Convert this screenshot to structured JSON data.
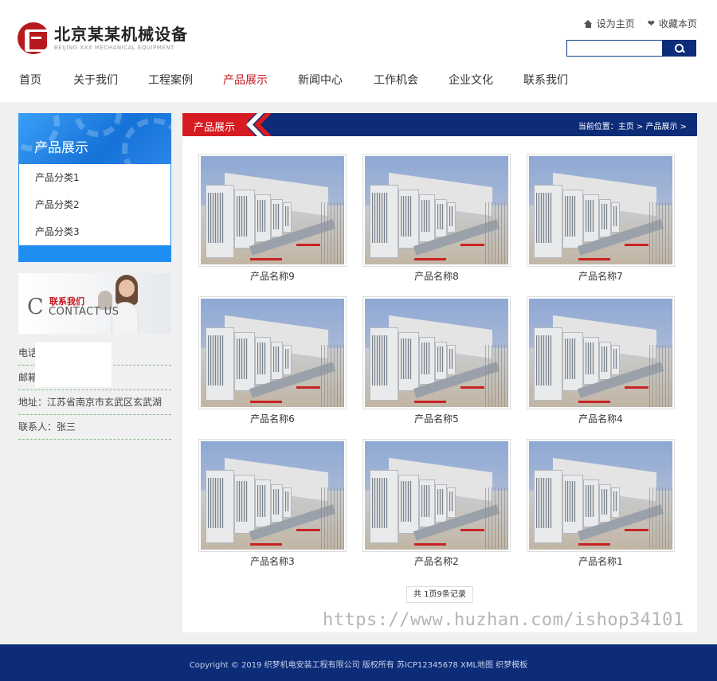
{
  "brand": {
    "name_cn": "北京某某机械设备",
    "name_en": "BEIJING XXX MECHANICAL EQUIPMENT",
    "color_red": "#c5171f",
    "color_blue": "#0c2c78"
  },
  "top_links": {
    "home": "设为主页",
    "favorite": "收藏本页",
    "home_icon": "home-icon",
    "favorite_icon": "heart-icon"
  },
  "search": {
    "value": "",
    "placeholder": "",
    "button_icon": "search-icon"
  },
  "nav": {
    "items": [
      "首页",
      "关于我们",
      "工程案例",
      "产品展示",
      "新闻中心",
      "工作机会",
      "企业文化",
      "联系我们"
    ],
    "active": "产品展示"
  },
  "sidebar": {
    "title": "产品展示",
    "categories": [
      "产品分类1",
      "产品分类2",
      "产品分类3"
    ]
  },
  "contact_banner": {
    "cn": "联系我们",
    "en": "CONTACT US"
  },
  "contact": {
    "phone": "电话：13",
    "email": "邮箱：ac                    com",
    "address": "地址：江苏省南京市玄武区玄武湖",
    "person": "联系人：张三"
  },
  "main": {
    "section_title": "产品展示",
    "breadcrumb": "当前位置：主页 > 产品展示 >",
    "products": [
      "产品名称9",
      "产品名称8",
      "产品名称7",
      "产品名称6",
      "产品名称5",
      "产品名称4",
      "产品名称3",
      "产品名称2",
      "产品名称1"
    ],
    "pagination": "共 1页9条记录"
  },
  "watermark": "https://www.huzhan.com/ishop34101",
  "footer": {
    "copyright": "Copyright © 2019 织梦机电安装工程有限公司 版权所有 苏ICP12345678 XML地图 织梦模板"
  }
}
